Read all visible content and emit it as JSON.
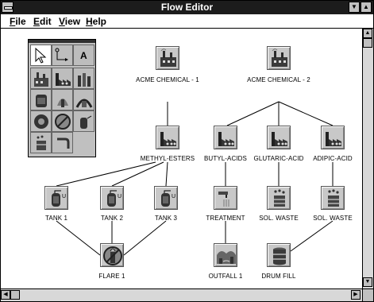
{
  "window": {
    "title": "Flow Editor"
  },
  "menu": [
    {
      "key": "F",
      "rest": "ile"
    },
    {
      "key": "E",
      "rest": "dit"
    },
    {
      "key": "V",
      "rest": "iew"
    },
    {
      "key": "H",
      "rest": "elp"
    }
  ],
  "palette": {
    "text_tool_label": "A",
    "tools": [
      "pointer-tool",
      "connector-tool",
      "text-tool",
      "plant-tool",
      "factory-tool",
      "chemical-tool",
      "tank-tool",
      "flare-tool",
      "treatment-tool",
      "valve-tool",
      "nonflare-tool",
      "drum-tool",
      "waste-tool",
      "pipe-tool"
    ]
  },
  "nodes": {
    "acme1": {
      "label": "ACME CHEMICAL - 1",
      "icon": "plant-icon"
    },
    "acme2": {
      "label": "ACME CHEMICAL - 2",
      "icon": "plant-icon"
    },
    "methyl": {
      "label": "METHYL-ESTERS",
      "icon": "factory-icon"
    },
    "butyl": {
      "label": "BUTYL-ACIDS",
      "icon": "factory-icon"
    },
    "glutaric": {
      "label": "GLUTARIC-ACID",
      "icon": "factory-icon"
    },
    "adipic": {
      "label": "ADIPIC-ACID",
      "icon": "factory-icon"
    },
    "tank1": {
      "label": "TANK 1",
      "icon": "tank-icon"
    },
    "tank2": {
      "label": "TANK 2",
      "icon": "tank-icon"
    },
    "tank3": {
      "label": "TANK 3",
      "icon": "tank-icon"
    },
    "treatment": {
      "label": "TREATMENT",
      "icon": "treatment-icon"
    },
    "solwaste1": {
      "label": "SOL. WASTE",
      "icon": "waste-drum-icon"
    },
    "solwaste2": {
      "label": "SOL. WASTE",
      "icon": "waste-drum-icon"
    },
    "flare1": {
      "label": "FLARE 1",
      "icon": "flare-icon"
    },
    "outfall1": {
      "label": "OUTFALL 1",
      "icon": "outfall-icon"
    },
    "drumfill": {
      "label": "DRUM FILL",
      "icon": "drum-icon"
    }
  },
  "colors": {
    "titlebar": "#1c1c1c",
    "node_bg": "#c8c8c8",
    "palette_bg": "#c0c0c0"
  }
}
